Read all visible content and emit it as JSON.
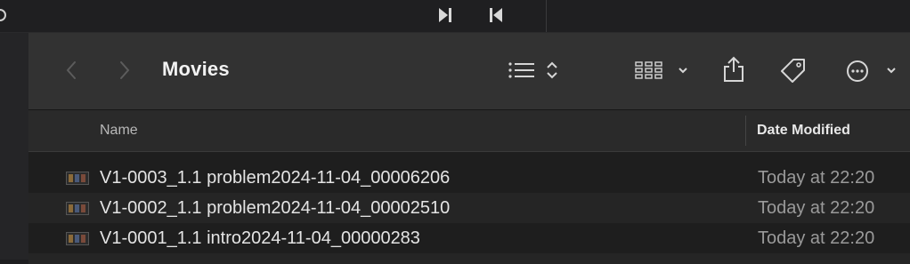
{
  "topbar": {
    "icons": [
      "partial-circle-icon",
      "skip-forward-icon",
      "skip-back-icon"
    ]
  },
  "toolbar": {
    "title": "Movies",
    "icons": [
      "back-chevron-icon",
      "forward-chevron-icon",
      "list-view-icon",
      "sort-arrows-icon",
      "grid-view-icon",
      "chevron-down-icon",
      "share-icon",
      "tag-icon",
      "more-icon",
      "chevron-down-icon"
    ]
  },
  "columns": {
    "name": "Name",
    "date_modified": "Date Modified"
  },
  "files": [
    {
      "name": "V1-0003_1.1 problem2024-11-04_00006206",
      "date": "Today at 22:20",
      "icon": "video-file-icon"
    },
    {
      "name": "V1-0002_1.1 problem2024-11-04_00002510",
      "date": "Today at 22:20",
      "icon": "video-file-icon"
    },
    {
      "name": "V1-0001_1.1 intro2024-11-04_00000283",
      "date": "Today at 22:20",
      "icon": "video-file-icon"
    }
  ],
  "colors": {
    "toolbar_bg": "#323232",
    "window_bg": "#1e1e1e",
    "row_alt_bg": "#252525"
  }
}
